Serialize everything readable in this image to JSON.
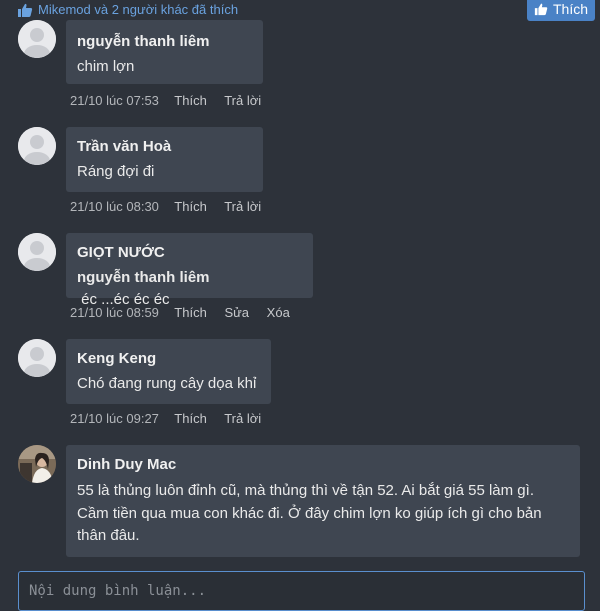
{
  "like_bar": {
    "liked_text": "Mikemod và 2 người khác đã thích",
    "like_button_label": "Thích"
  },
  "comments": [
    {
      "author": "nguyễn thanh liêm",
      "text": "chim lợn",
      "time": "21/10 lúc 07:53",
      "actions": [
        "Thích",
        "Trả lời"
      ]
    },
    {
      "author": "Trần văn Hoà",
      "text": "Ráng đợi đi",
      "time": "21/10 lúc 08:30",
      "actions": [
        "Thích",
        "Trả lời"
      ]
    },
    {
      "author": "GIỌT NƯỚC",
      "mention": "nguyễn thanh liêm",
      "text": " éc ...éc éc éc",
      "time": "21/10 lúc 08:59",
      "actions": [
        "Thích",
        "Sửa",
        "Xóa"
      ]
    },
    {
      "author": "Keng Keng",
      "text": "Chó đang rung cây dọa khỉ",
      "time": "21/10 lúc 09:27",
      "actions": [
        "Thích",
        "Trả lời"
      ]
    },
    {
      "author": "Dinh Duy Mac",
      "lines": [
        "55 là thủng luôn đỉnh cũ, mà thủng thì về tận 52. Ai bắt giá 55 làm gì.",
        "Cầm tiền qua mua con khác đi. Ở đây chim lợn ko giúp ích gì cho bản",
        "thân đâu."
      ]
    }
  ],
  "comment_input": {
    "placeholder": "Nội dung bình luận..."
  },
  "colors": {
    "background": "#2d323a",
    "bubble": "#3f4651",
    "accent": "#4a82c6",
    "link": "#6aa2df"
  }
}
